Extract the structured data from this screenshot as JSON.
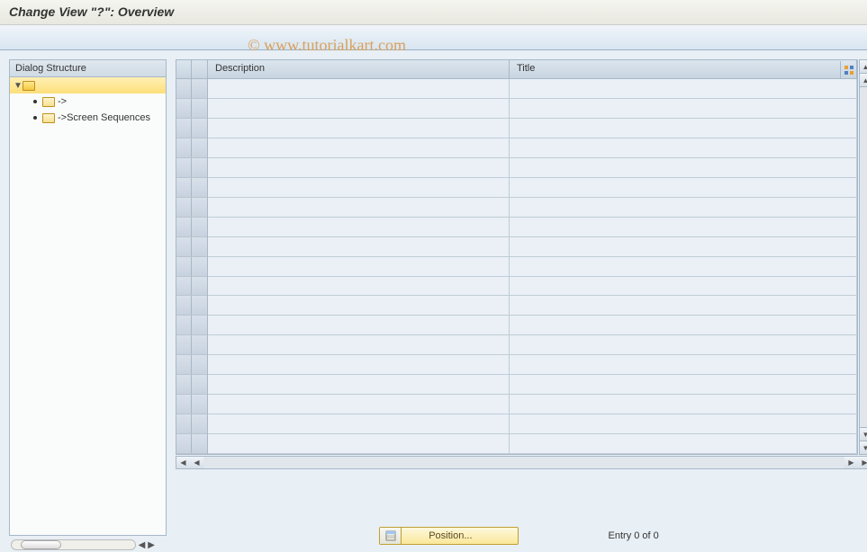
{
  "title": "Change View \"?\": Overview",
  "watermark": "© www.tutorialkart.com",
  "tree": {
    "header": "Dialog Structure",
    "root_label": "",
    "child1_label": "->",
    "child2_label": "->Screen Sequences"
  },
  "grid": {
    "columns": {
      "description": "Description",
      "title": "Title"
    }
  },
  "footer": {
    "position_button": "Position...",
    "entry_status": "Entry 0 of 0"
  }
}
